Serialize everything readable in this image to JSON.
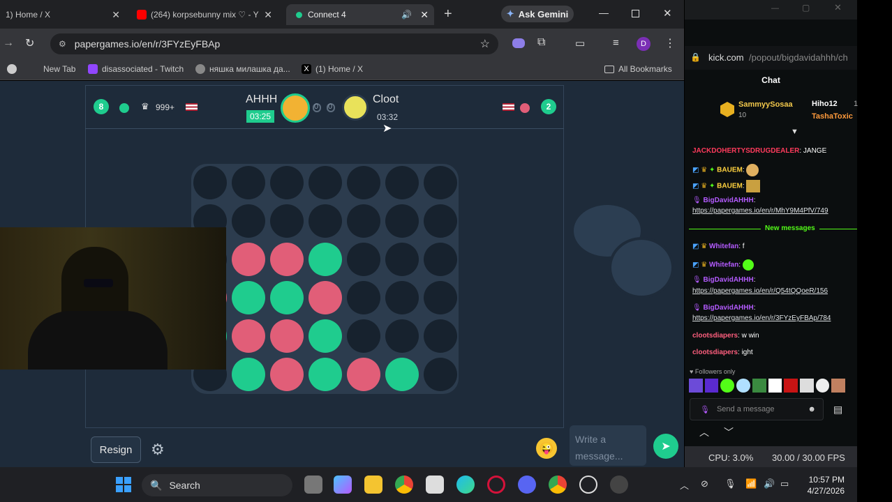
{
  "tabs": [
    {
      "label": "1) Home / X"
    },
    {
      "label": "(264) korpsebunny mix ♡ - Y"
    },
    {
      "label": "Connect 4"
    }
  ],
  "gemini_label": "Ask Gemini",
  "url": "papergames.io/en/r/3FYzEyFBAp",
  "profile_letter": "D",
  "bookmarks": [
    "New Tab",
    "disassociated - Twitch",
    "няшка милашка да...",
    "(1) Home / X"
  ],
  "all_bookmarks": "All Bookmarks",
  "game": {
    "left": {
      "badge": "8",
      "crown_count": "999+",
      "name": "AHHH",
      "timer": "03:25",
      "score": "0"
    },
    "right": {
      "badge": "2",
      "name": "Cloot",
      "timer": "03:32",
      "score": "0"
    },
    "board": [
      [
        "e",
        "e",
        "e",
        "e",
        "e",
        "e",
        "e"
      ],
      [
        "e",
        "e",
        "e",
        "e",
        "e",
        "e",
        "e"
      ],
      [
        "e",
        "r",
        "r",
        "g",
        "e",
        "e",
        "e"
      ],
      [
        "r",
        "g",
        "g",
        "r",
        "e",
        "e",
        "e"
      ],
      [
        "g",
        "r",
        "r",
        "g",
        "e",
        "e",
        "e"
      ],
      [
        "e",
        "g",
        "r",
        "g",
        "r",
        "g",
        "e"
      ]
    ],
    "resign_label": "Resign",
    "chat_placeholder": "Write a message...",
    "colors": {
      "red": "#e15e78",
      "green": "#1fcc8e"
    }
  },
  "taskbar": {
    "search_label": "Search",
    "time": "10:57 PM",
    "date": "4/27/2026"
  },
  "kick": {
    "url_host": "kick.com",
    "url_path": "/popout/bigdavidahhh/ch",
    "chat_title": "Chat",
    "top_users": [
      {
        "name": "SammyySosaa",
        "count": "10"
      },
      {
        "name": "Hiho12",
        "count": "1"
      },
      {
        "name": "TashaToxic",
        "count": ""
      }
    ],
    "messages": [
      {
        "user": "JACKDOHERTYSDRUGDEALER",
        "text": ": JANGE",
        "color": "#ff3b5c"
      },
      {
        "user": "BAUEM",
        "text": ":",
        "color": "#ffd23f"
      },
      {
        "user": "BAUEM",
        "text": ":",
        "color": "#ffd23f"
      },
      {
        "user": "BigDavidAHHH",
        "text": ":",
        "color": "#b45bff"
      },
      {
        "user": "",
        "text": "https://papergames.io/en/r/MhY9M4PfV/749",
        "color": "#dfe3e6"
      },
      {
        "user": "Whitefan",
        "text": ": f",
        "color": "#b45bff"
      },
      {
        "user": "Whitefan",
        "text": ":",
        "color": "#b45bff"
      },
      {
        "user": "BigDavidAHHH",
        "text": ":",
        "color": "#b45bff"
      },
      {
        "user": "",
        "text": "https://papergames.io/en/r/Q54tQQoeR/156",
        "color": "#dfe3e6"
      },
      {
        "user": "BigDavidAHHH",
        "text": ":",
        "color": "#b45bff"
      },
      {
        "user": "",
        "text": "https://papergames.io/en/r/3FYzEyFBAp/784",
        "color": "#dfe3e6"
      },
      {
        "user": "clootsdiapers",
        "text": ": w win",
        "color": "#ff5f7e"
      },
      {
        "user": "clootsdiapers",
        "text": ": ight",
        "color": "#ff5f7e"
      }
    ],
    "new_messages": "New messages",
    "followers_only": "Followers only",
    "send_placeholder": "Send a message"
  },
  "obs": {
    "cpu": "CPU: 3.0%",
    "fps": "30.00 / 30.00 FPS"
  }
}
